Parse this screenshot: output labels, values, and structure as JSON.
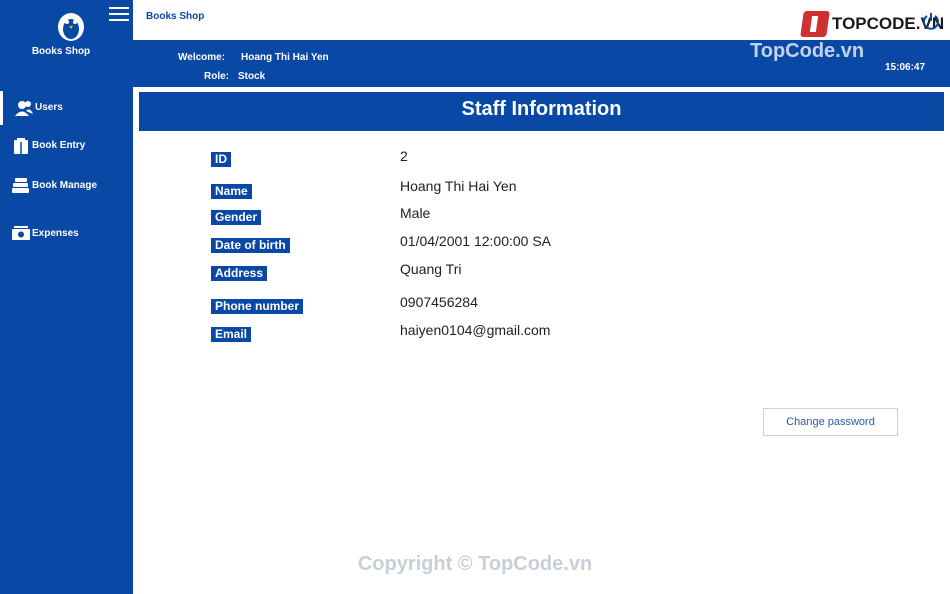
{
  "app": {
    "brand": "Books Shop",
    "topbar_title": "Books Shop"
  },
  "sidebar": {
    "items": [
      {
        "label": "Users",
        "icon": "users-icon"
      },
      {
        "label": "Book Entry",
        "icon": "book-entry-icon"
      },
      {
        "label": "Book Manage",
        "icon": "books-stack-icon"
      },
      {
        "label": "Expenses",
        "icon": "money-icon"
      }
    ]
  },
  "header": {
    "welcome_label": "Welcome:",
    "welcome_value": "Hoang Thi Hai Yen",
    "role_label": "Role:",
    "role_value": "Stock",
    "clock": "15:06:47"
  },
  "main": {
    "title": "Staff Information",
    "fields": [
      {
        "label": "ID",
        "value": "2"
      },
      {
        "label": "Name",
        "value": "Hoang Thi Hai Yen"
      },
      {
        "label": "Gender",
        "value": "Male"
      },
      {
        "label": "Date of birth",
        "value": "01/04/2001 12:00:00 SA"
      },
      {
        "label": "Address",
        "value": "Quang Tri"
      },
      {
        "label": "Phone number",
        "value": "0907456284"
      },
      {
        "label": "Email",
        "value": "haiyen0104@gmail.com"
      }
    ],
    "change_password_label": "Change password"
  },
  "watermark": {
    "logo_text": "TOPCODE.VN",
    "top_text": "TopCode.vn",
    "copyright": "Copyright © TopCode.vn"
  },
  "colors": {
    "primary": "#0a48a6",
    "background": "#ffffff"
  }
}
